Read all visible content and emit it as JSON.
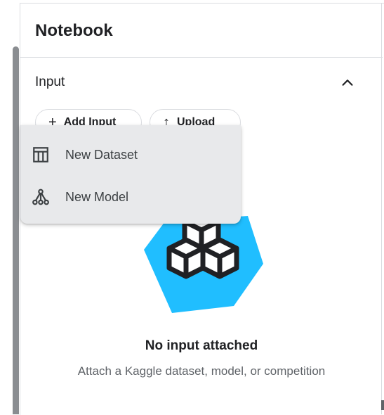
{
  "panel": {
    "title": "Notebook",
    "section": {
      "title": "Input",
      "toggle_icon": "chevron-up-icon"
    },
    "buttons": {
      "add_input": {
        "label": "Add Input",
        "icon": "plus-icon"
      },
      "upload": {
        "label": "Upload",
        "icon": "upload-icon"
      }
    },
    "dropdown": {
      "items": [
        {
          "label": "New Dataset",
          "icon": "table-icon"
        },
        {
          "label": "New Model",
          "icon": "model-graph-icon"
        }
      ]
    },
    "empty_state": {
      "title": "No input attached",
      "subtitle": "Attach a Kaggle dataset, model, or competition",
      "illustration": "cubes-illustration",
      "accent_color": "#20BEFF"
    }
  }
}
